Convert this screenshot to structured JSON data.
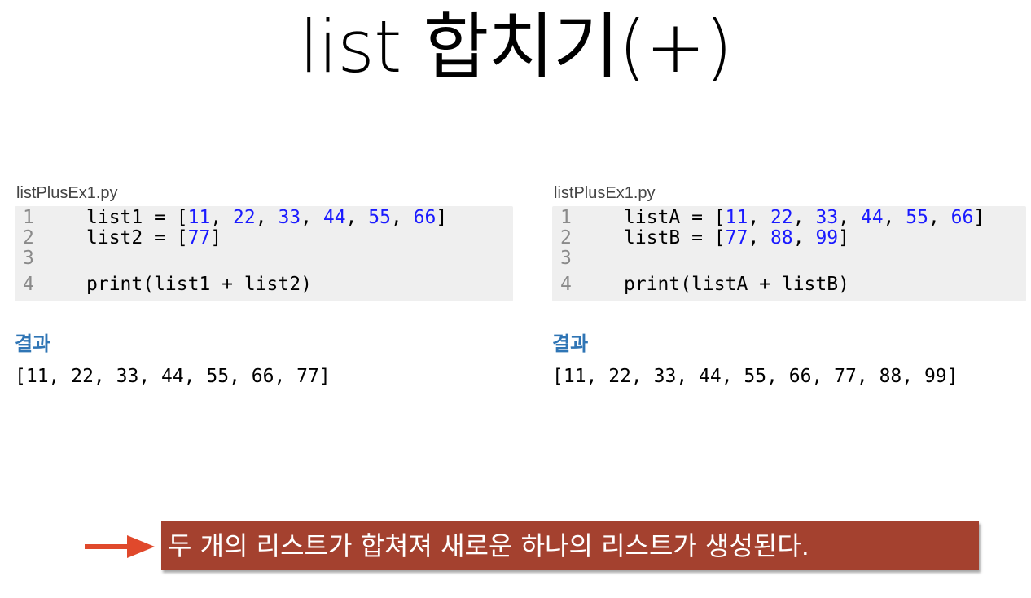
{
  "title": "list 합치기(+)",
  "left": {
    "filename": "listPlusEx1.py",
    "lines": [
      {
        "no": "1",
        "segments": [
          [
            "list1 = [",
            "t"
          ],
          [
            "11",
            "n"
          ],
          [
            ", ",
            "t"
          ],
          [
            "22",
            "n"
          ],
          [
            ", ",
            "t"
          ],
          [
            "33",
            "n"
          ],
          [
            ", ",
            "t"
          ],
          [
            "44",
            "n"
          ],
          [
            ", ",
            "t"
          ],
          [
            "55",
            "n"
          ],
          [
            ", ",
            "t"
          ],
          [
            "66",
            "n"
          ],
          [
            "]",
            "t"
          ]
        ]
      },
      {
        "no": "2",
        "segments": [
          [
            "list2 = [",
            "t"
          ],
          [
            "77",
            "n"
          ],
          [
            "]",
            "t"
          ]
        ]
      },
      {
        "no": "3",
        "segments": []
      },
      {
        "no": "4",
        "segments": [
          [
            "print(list1 + list2)",
            "t"
          ]
        ]
      }
    ],
    "result_label": "결과",
    "result": "[11, 22, 33, 44, 55, 66, 77]"
  },
  "right": {
    "filename": "listPlusEx1.py",
    "lines": [
      {
        "no": "1",
        "segments": [
          [
            "listA = [",
            "t"
          ],
          [
            "11",
            "n"
          ],
          [
            ", ",
            "t"
          ],
          [
            "22",
            "n"
          ],
          [
            ", ",
            "t"
          ],
          [
            "33",
            "n"
          ],
          [
            ", ",
            "t"
          ],
          [
            "44",
            "n"
          ],
          [
            ", ",
            "t"
          ],
          [
            "55",
            "n"
          ],
          [
            ", ",
            "t"
          ],
          [
            "66",
            "n"
          ],
          [
            "]",
            "t"
          ]
        ]
      },
      {
        "no": "2",
        "segments": [
          [
            "listB = [",
            "t"
          ],
          [
            "77",
            "n"
          ],
          [
            ", ",
            "t"
          ],
          [
            "88",
            "n"
          ],
          [
            ", ",
            "t"
          ],
          [
            "99",
            "n"
          ],
          [
            "]",
            "t"
          ]
        ]
      },
      {
        "no": "3",
        "segments": []
      },
      {
        "no": "4",
        "segments": [
          [
            "print(listA + listB)",
            "t"
          ]
        ]
      }
    ],
    "result_label": "결과",
    "result": "[11, 22, 33, 44, 55, 66, 77, 88, 99]"
  },
  "callout": "두 개의 리스트가 합쳐져 새로운 하나의 리스트가 생성된다.",
  "colors": {
    "number": "#1a1aff",
    "result_label": "#2f75b5",
    "callout_bg": "#a4412f",
    "arrow": "#e0492c"
  },
  "icons": {
    "arrow": "right-arrow-icon"
  }
}
